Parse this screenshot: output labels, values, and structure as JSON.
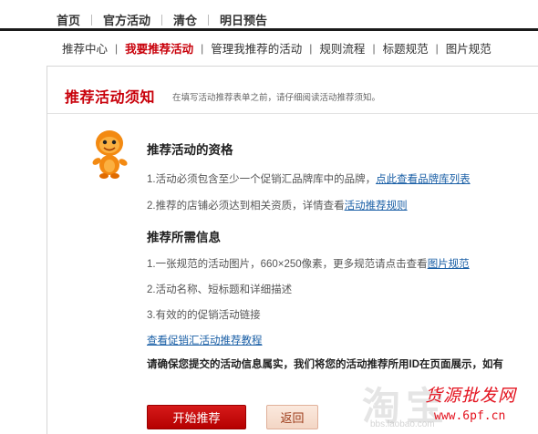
{
  "top_nav": {
    "items": [
      "首页",
      "官方活动",
      "清仓",
      "明日预告"
    ]
  },
  "sub_nav": {
    "items": [
      "推荐中心",
      "我要推荐活动",
      "管理我推荐的活动",
      "规则流程",
      "标题规范",
      "图片规范"
    ],
    "active_index": 1
  },
  "panel": {
    "title": "推荐活动须知",
    "hint": "在填写活动推荐表单之前，请仔细阅读活动推荐须知。"
  },
  "qualification": {
    "title": "推荐活动的资格",
    "line1_text": "1.活动必须包含至少一个促销汇品牌库中的品牌，",
    "line1_link": "点此查看品牌库列表",
    "line2_text": "2.推荐的店铺必须达到相关资质，详情查看",
    "line2_link": "活动推荐规则"
  },
  "required_info": {
    "title": "推荐所需信息",
    "line1_text": "1.一张规范的活动图片，660×250像素，更多规范请点击查看",
    "line1_link": "图片规范",
    "line2_text": "2.活动名称、短标题和详细描述",
    "line3_text": "3.有效的的促销活动链接",
    "tutorial_link": "查看促销汇活动推荐教程"
  },
  "warning": "请确保您提交的活动信息属实，我们将您的活动推荐所用ID在页面展示，如有",
  "buttons": {
    "start": "开始推荐",
    "back": "返回"
  },
  "watermark": {
    "gray_text": "淘宝",
    "gray_url": "bbs.laobao.com",
    "site_name": "货源批发网",
    "site_url": "www.6pf.cn"
  },
  "colors": {
    "brand_red": "#c8000a",
    "link_blue": "#1a5fa6"
  }
}
